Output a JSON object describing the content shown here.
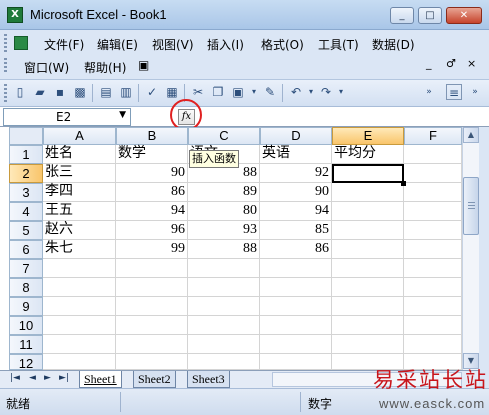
{
  "window": {
    "title": "Microsoft Excel - Book1",
    "buttons": [
      "_",
      "□",
      "✕"
    ]
  },
  "menu": {
    "items": [
      "文件(F)",
      "编辑(E)",
      "视图(V)",
      "插入(I)",
      "格式(O)",
      "工具(T)",
      "数据(D)",
      "窗口(W)",
      "帮助(H)"
    ],
    "mdi_buttons": [
      "_",
      "♂",
      "×"
    ]
  },
  "formula_bar": {
    "name_box": "E2",
    "fx_label": "fx",
    "value": ""
  },
  "tooltip": "插入函数",
  "columns": [
    "A",
    "B",
    "C",
    "D",
    "E",
    "F"
  ],
  "rows": [
    "1",
    "2",
    "3",
    "4",
    "5",
    "6",
    "7",
    "8",
    "9",
    "10",
    "11",
    "12"
  ],
  "table": {
    "headers": [
      "姓名",
      "数学",
      "语文",
      "英语",
      "平均分"
    ],
    "rows": [
      [
        "张三",
        "90",
        "88",
        "92",
        ""
      ],
      [
        "李四",
        "86",
        "89",
        "90",
        ""
      ],
      [
        "王五",
        "94",
        "80",
        "94",
        ""
      ],
      [
        "赵六",
        "96",
        "93",
        "85",
        ""
      ],
      [
        "朱七",
        "99",
        "88",
        "86",
        ""
      ]
    ]
  },
  "sheets": [
    "Sheet1",
    "Sheet2",
    "Sheet3"
  ],
  "status": {
    "ready": "就绪",
    "numlock": "数字"
  },
  "watermark": {
    "main": "易采站长站",
    "sub": "www.easck.com"
  }
}
